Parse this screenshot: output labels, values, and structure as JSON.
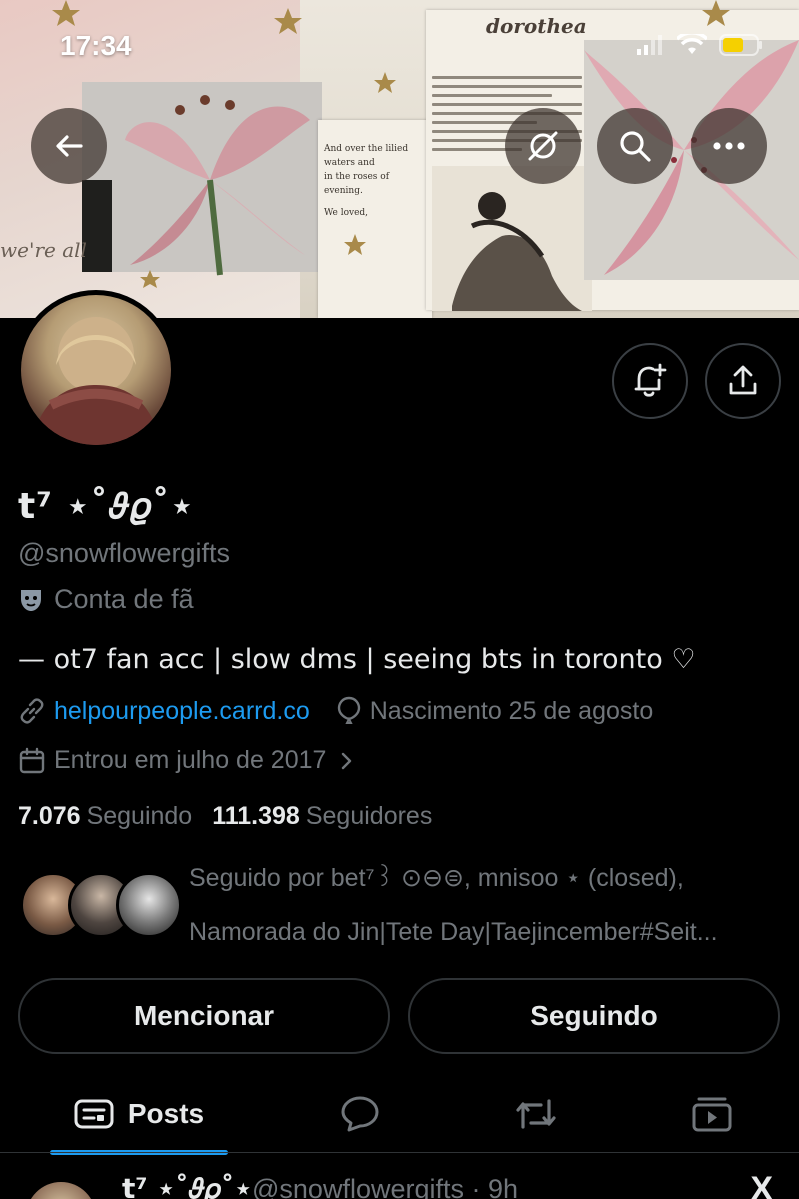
{
  "status_bar": {
    "time": "17:34"
  },
  "banner": {
    "title_text": "dorothea",
    "scrap_text_1": "And over the lilied waters and",
    "scrap_text_2": "in the roses of evening.",
    "scrap_text_3": "We loved,",
    "scrap_text_4": "we're all"
  },
  "profile": {
    "display_name": "t⁷ ⋆˚𝜗𝜚˚⋆",
    "handle": "@snowflowergifts",
    "category": "Conta de fã",
    "bio": "— ot7 fan acc | slow dms | seeing bts in toronto ♡",
    "link": "helpourpeople.carrd.co",
    "birthday": "Nascimento 25 de agosto",
    "joined": "Entrou em julho de 2017",
    "following_count": "7.076",
    "following_label": "Seguindo",
    "followers_count": "111.398",
    "followers_label": "Seguidores",
    "followed_by_line1": "Seguido por bet⁷꒱ ⊙⊖⊜, mnisoo ⋆ (closed),",
    "followed_by_line2": "Namorada do Jin|Tete Day|Taejincember#Seit..."
  },
  "actions": {
    "mention": "Mencionar",
    "following": "Seguindo"
  },
  "tabs": {
    "posts": "Posts"
  },
  "post_preview": {
    "name": "t⁷ ⋆˚𝜗𝜚˚⋆",
    "handle_time": "@snowflowergifts · 9h"
  },
  "colors": {
    "accent": "#1d9bf0",
    "background": "#000000",
    "secondary_text": "#71767b"
  }
}
